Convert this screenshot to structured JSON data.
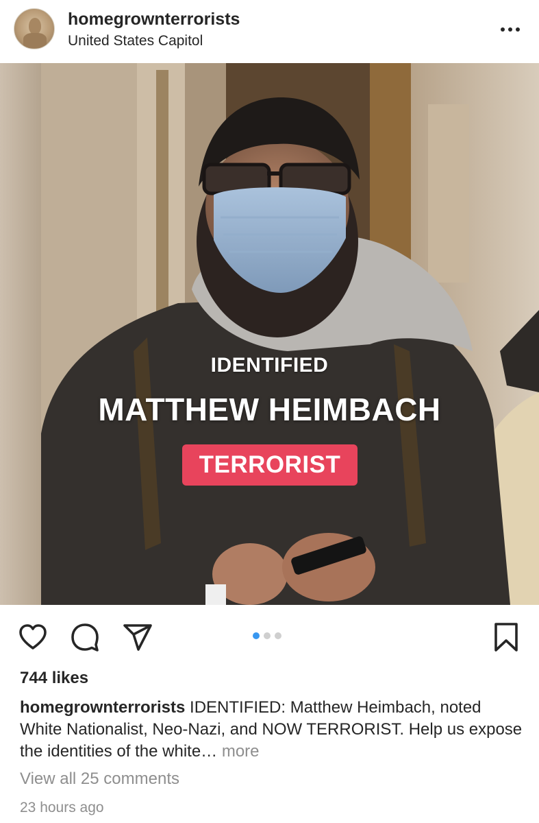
{
  "post": {
    "username": "homegrownterrorists",
    "location": "United States Capitol",
    "more_icon": "more-horizontal-icon"
  },
  "image": {
    "overlay": {
      "label": "IDENTIFIED",
      "name": "MATTHEW HEIMBACH",
      "badge": "TERRORIST"
    },
    "colors": {
      "badge": "#e8445c",
      "text": "#ffffff"
    }
  },
  "actions": {
    "icons": [
      "heart-icon",
      "comment-icon",
      "share-icon",
      "bookmark-icon"
    ],
    "carousel": {
      "total": 3,
      "active": 1,
      "active_color": "#3897f0"
    }
  },
  "likes": "744 likes",
  "caption": {
    "username": "homegrownterrorists",
    "text": "IDENTIFIED: Matthew Heimbach, noted White Nationalist, Neo-Nazi, and NOW TERRORIST. Help us expose the identities of the white…",
    "more": "more"
  },
  "view_comments": "View all 25 comments",
  "timestamp": "23 hours ago"
}
